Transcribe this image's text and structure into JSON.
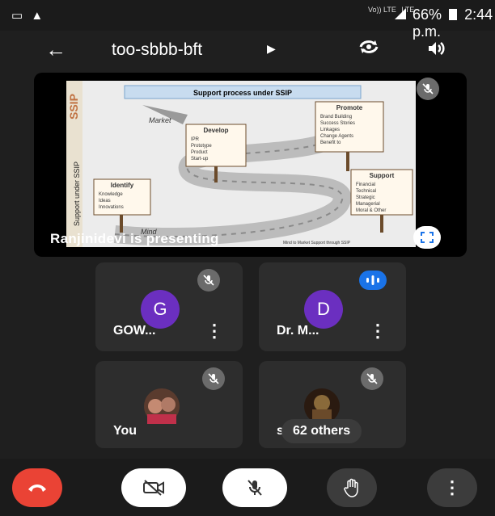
{
  "status_bar": {
    "left_icons": [
      "cast-icon",
      "warning-icon"
    ],
    "net_labels": [
      "Vo)) LTE",
      "LTE"
    ],
    "battery": "66%",
    "time": "2:44 p.m."
  },
  "header": {
    "meeting_code": "too-sbbb-bft"
  },
  "presentation": {
    "presenter_text": "Ranjinidevi is presenting",
    "slide": {
      "vertical_brand": "SSIP",
      "title": "Support process under SSIP",
      "side_text": "Support under SSIP",
      "market": "Market",
      "mind": "Mind",
      "footer": "Mind to Market Support through SSIP",
      "signs": [
        {
          "heading": "Promote",
          "items": [
            "Brand Building",
            "Success Stories",
            "Linkages",
            "Change Agents",
            "Benefit to"
          ]
        },
        {
          "heading": "Develop",
          "items": [
            "IPR",
            "Prototype",
            "Product",
            "Start-up"
          ]
        },
        {
          "heading": "Identify",
          "items": [
            "Knowledge",
            "Ideas",
            "Innovations"
          ]
        },
        {
          "heading": "Support",
          "items": [
            "Financial",
            "Technical",
            "Strategic",
            "Managerial",
            "Moral & Other"
          ]
        }
      ]
    }
  },
  "participants": [
    {
      "initial": "G",
      "name": "GOW...",
      "muted": true
    },
    {
      "initial": "D",
      "name": "Dr. M...",
      "muted": false,
      "speaking": true
    },
    {
      "name": "You",
      "muted": true
    },
    {
      "name": "s",
      "others_label": "62 others",
      "muted": true
    }
  ],
  "colors": {
    "end_call": "#ea4335",
    "avatar": "#6b2fc0",
    "speaking": "#1a73e8",
    "tile": "#2d2d2d"
  }
}
